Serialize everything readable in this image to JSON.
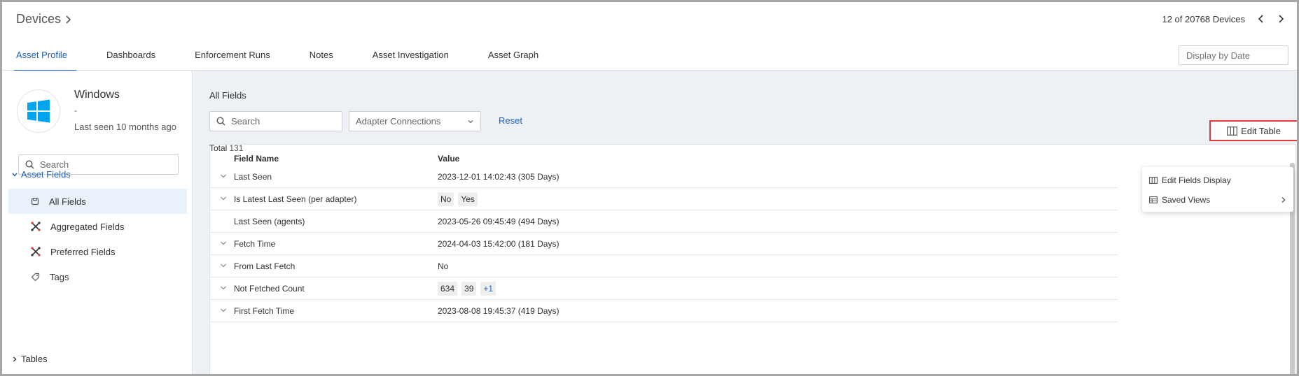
{
  "header": {
    "breadcrumb": "Devices",
    "pager_text": "12 of 20768 Devices",
    "date_placeholder": "Display by Date"
  },
  "tabs": [
    "Asset Profile",
    "Dashboards",
    "Enforcement Runs",
    "Notes",
    "Asset Investigation",
    "Asset Graph"
  ],
  "sidebar": {
    "device_name": "Windows",
    "device_subtitle": "-",
    "last_seen": "Last seen 10 months ago",
    "search_placeholder": "Search",
    "section_open": "Asset Fields",
    "items": [
      {
        "label": "All Fields",
        "icon": "cube-icon"
      },
      {
        "label": "Aggregated Fields",
        "icon": "aggregate-icon"
      },
      {
        "label": "Preferred Fields",
        "icon": "aggregate-icon"
      },
      {
        "label": "Tags",
        "icon": "tag-icon"
      }
    ],
    "section_closed": "Tables"
  },
  "main": {
    "title": "All Fields",
    "search_placeholder": "Search",
    "adapter_select": "Adapter Connections",
    "reset": "Reset",
    "total_label": "Total",
    "total_count": "131",
    "edit_table": "Edit Table",
    "columns": {
      "field": "Field Name",
      "value": "Value"
    },
    "rows": [
      {
        "field": "Last Seen",
        "value": "2023-12-01 14:02:43 (305 Days)",
        "expandable": true
      },
      {
        "field": "Is Latest Last Seen (per adapter)",
        "chips": [
          "No",
          "Yes"
        ],
        "expandable": true
      },
      {
        "field": "Last Seen (agents)",
        "value": "2023-05-26 09:45:49 (494 Days)",
        "expandable": false
      },
      {
        "field": "Fetch Time",
        "value": "2024-04-03 15:42:00 (181 Days)",
        "expandable": true
      },
      {
        "field": "From Last Fetch",
        "value": "No",
        "expandable": true
      },
      {
        "field": "Not Fetched Count",
        "chips": [
          "634",
          "39"
        ],
        "more": "+1",
        "expandable": true
      },
      {
        "field": "First Fetch Time",
        "value": "2023-08-08 19:45:37 (419 Days)",
        "expandable": true
      }
    ]
  },
  "dropdown": {
    "items": [
      "Edit Fields Display",
      "Saved Views"
    ]
  },
  "colors": {
    "accent": "#1f5fbf",
    "highlight_border": "#e0393e",
    "windows_blue": "#00a4ef"
  }
}
